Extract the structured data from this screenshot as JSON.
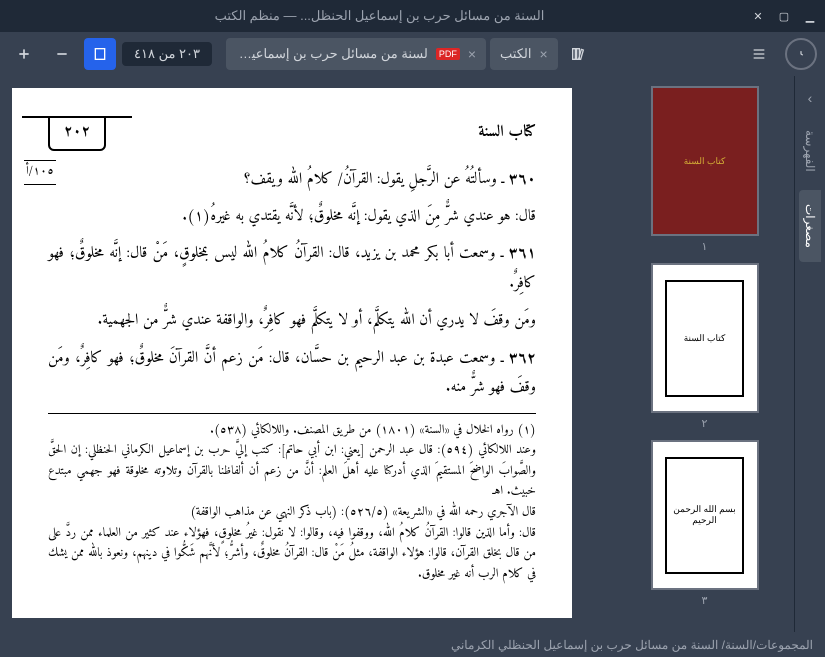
{
  "window": {
    "title": "السنة من مسائل حرب بن إسماعيل الحنظل... — منظم الكتب"
  },
  "toolbar": {
    "page_indicator": "٢٠٣ من ٤١٨"
  },
  "tabs": [
    {
      "label": "لسنة من مسائل حرب بن إسماعيل الحنظل.",
      "kind": "pdf"
    },
    {
      "label": "الكتب",
      "kind": "books"
    }
  ],
  "side_tabs": {
    "index": "الفهرسة",
    "thumbnails": "مصغرات"
  },
  "thumbnails": [
    {
      "num": "١",
      "style": "cover"
    },
    {
      "num": "٢",
      "style": "inner"
    },
    {
      "num": "٣",
      "style": "inner"
    }
  ],
  "breadcrumb": "المجموعات/السنة/ السنة من مسائل حرب بن إسماعيل الحنظلي الكرماني",
  "page": {
    "book_title": "كتاب السنة",
    "page_number": "٢٠٢",
    "side_note": "١٠٥/أ",
    "entry_360_label": "٣٦٠",
    "entry_360_q": "ـ وسألتُهُ عن الرَّجلِ يقول: القرآنُ/ كلامُ الله ويقف؟",
    "entry_360_a": "قال: هو عندي شرٌّ مِنَ الذي يقول: إنَّه مخلوقٌ؛ لأنَّه يقتدي به غيرهُ(١).",
    "entry_361_label": "٣٦١",
    "entry_361": "ـ وسمعت أبا بكر محمد بن يزيد، قال: القرآنُ كلامُ الله ليس بمخلوقٍ، مَنْ قال: إنَّه مخلوقٌ؛ فهو كافِرٌ.",
    "entry_361b": "ومَن وقفَ لا يدري أن الله يتكلَّم، أو لا يتكلَّم فهو كافِرٌ، والواقفة عندي شرٌّ من الجهمية.",
    "entry_362_label": "٣٦٢",
    "entry_362": "ـ وسمعت عبدة بن عبد الرحيم بن حسَّان، قال: مَن زعم أنَّ القرآنَ مخلوقٌ؛ فهو كافِرٌ، ومَن وقفَ فهو شرٌّ منه.",
    "footnote": "(١) رواه الخلال في «السنة» (١٨٠١) من طريق المصنف. واللالكائي (٥٣٨).\nوعند اللالكائي (٥٩٤): قال عبد الرحمن [يعني: ابن أبي حاتم]: كتب إليَّ حرب بن إسماعيل الكرماني الحنظلي: إن الحقَّ والصَّوابَ الواضحَ المستقيمَ الذي أدركنا عليه أهلَ العلم: أنَّ من زعم أن ألفاظنا بالقرآن وتلاوته مخلوقة فهو جهمي مبتدع خبيث. اهـ\nقال الآجري رحمه الله في «الشريعة» (٥٢٦/٥): (باب ذكر النهي عن مذاهب الواقفة)\nقال: وأما الذين قالوا: القرآنُ كلامُ الله، ووقفوا فيه، وقالوا: لا نقول: غيرُ مخلوقٍ، فهؤلاء عند كثير من العلماء ممن ردَّ على من قال بخلق القرآن، قالوا: هؤلاء الواقفة، مثلُ مَنْ قال: القرآنُ مخلوقٌ، وأشرُّ؛ لأنَّهم شَكُّوا في دينهم، ونعوذ بالله ممن يشك في كلام الرب أنه غير مخلوق."
  }
}
